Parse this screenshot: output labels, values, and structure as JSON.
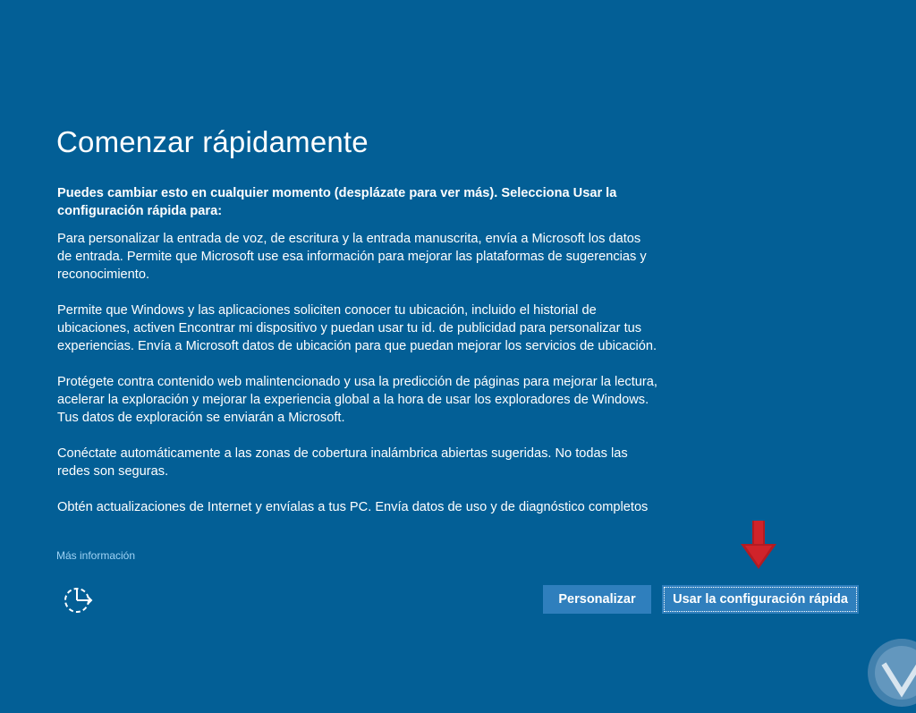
{
  "header": {
    "title": "Comenzar rápidamente"
  },
  "content": {
    "intro": "Puedes cambiar esto en cualquier momento (desplázate para ver más). Selecciona Usar la configuración rápida para:",
    "paragraphs": [
      "Para personalizar la entrada de voz, de escritura y la entrada manuscrita, envía a Microsoft los datos de entrada. Permite que Microsoft use esa información para mejorar las plataformas de sugerencias y reconocimiento.",
      "Permite que Windows y las aplicaciones soliciten conocer tu ubicación, incluido el historial de ubicaciones, activen Encontrar mi dispositivo y puedan usar tu id. de publicidad para personalizar tus experiencias. Envía a Microsoft datos de ubicación para que puedan mejorar los servicios de ubicación.",
      "Protégete contra contenido web malintencionado y usa la predicción de páginas para mejorar la lectura, acelerar la exploración y mejorar la experiencia global a la hora de usar los exploradores de Windows. Tus datos de exploración se enviarán a Microsoft.",
      "Conéctate automáticamente a las zonas de cobertura inalámbrica abiertas sugeridas. No todas las redes son seguras.",
      "Obtén actualizaciones de Internet y envíalas a tus PC. Envía datos de uso y de diagnóstico completos"
    ]
  },
  "footer": {
    "more_info_link": "Más información",
    "ease_of_access_icon": "ease-of-access-icon",
    "customize_button": "Personalizar",
    "express_button": "Usar la configuración rápida"
  },
  "colors": {
    "background": "#035f96",
    "button": "#2f7fbd",
    "link": "#9fd3f5",
    "arrow": "#d0232a"
  }
}
